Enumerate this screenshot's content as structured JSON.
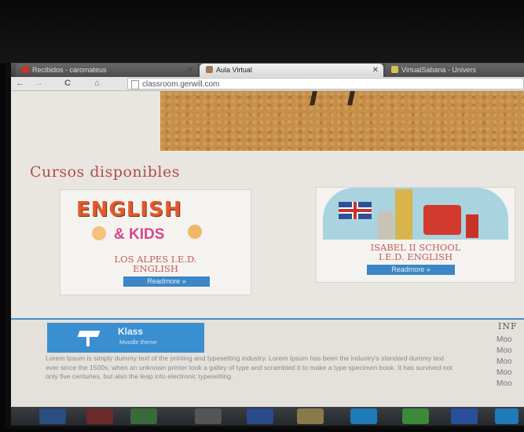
{
  "browser": {
    "tabs": [
      {
        "label": "Recibidos - caromateus",
        "favicon_color": "#c8322a"
      },
      {
        "label": "Aula Virtual",
        "favicon_color": "#9b7a55"
      },
      {
        "label": "VirtualSabana - Univers",
        "favicon_color": "#d7c34a"
      }
    ],
    "address": "classroom.gerwill.com"
  },
  "page": {
    "heading": "Cursos disponibles",
    "courses": [
      {
        "title_line1": "LOS ALPES I.E.D.",
        "title_line2": "ENGLISH",
        "button": "Readmore »",
        "logo_text1": "ENGLISH",
        "logo_text2": "& KIDS"
      },
      {
        "title_line1": "ISABEL II SCHOOL",
        "title_line2": "I.E.D. ENGLISH",
        "button": "Readmore »"
      }
    ]
  },
  "footer": {
    "brand": "Klass",
    "brand_sub": "Moodle theme",
    "text": "Lorem Ipsum is simply dummy text of the printing and typesetting industry. Lorem Ipsum has been the industry's standard dummy text ever since the 1500s, when an unknown printer took a galley of type and scrambled it to make a type specimen book. It has survived not only five centuries, but also the leap into electronic typesetting.",
    "info_title": "INF",
    "info_items": [
      "Moo",
      "Moo",
      "Moo",
      "Moo",
      "Moo"
    ]
  },
  "colors": {
    "accent": "#3b86c6",
    "heading": "#b14d4d",
    "course_title": "#c55a5a"
  }
}
